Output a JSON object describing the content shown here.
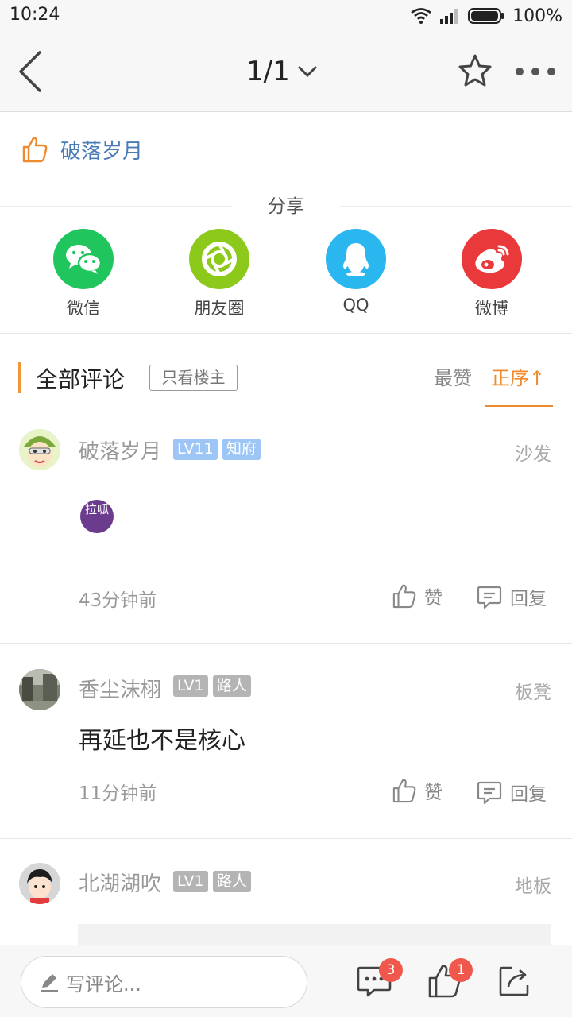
{
  "status_bar": {
    "time": "10:24",
    "battery": "100%"
  },
  "nav": {
    "page_indicator": "1/1"
  },
  "author_like": {
    "name": "破落岁月"
  },
  "share": {
    "title": "分享",
    "items": [
      {
        "label": "微信",
        "icon": "wechat-icon",
        "color": "#21c55d"
      },
      {
        "label": "朋友圈",
        "icon": "moments-icon",
        "color": "#8cc91a"
      },
      {
        "label": "QQ",
        "icon": "qq-icon",
        "color": "#2ab6ee"
      },
      {
        "label": "微博",
        "icon": "weibo-icon",
        "color": "#e9393b"
      }
    ]
  },
  "comments_header": {
    "title": "全部评论",
    "only_author": "只看楼主",
    "sort_hot": "最赞",
    "sort_order": "正序↑"
  },
  "comments": [
    {
      "name": "破落岁月",
      "level": "LV11",
      "title_badge": "知府",
      "floor": "沙发",
      "text": "",
      "sticker": "拉呱",
      "time": "43分钟前",
      "like": "赞",
      "reply": "回复"
    },
    {
      "name": "香尘沫栩",
      "level": "LV1",
      "title_badge": "路人",
      "floor": "板凳",
      "text": "再延也不是核心",
      "time": "11分钟前",
      "like": "赞",
      "reply": "回复"
    },
    {
      "name": "北湖湖吹",
      "level": "LV1",
      "title_badge": "路人",
      "floor": "地板"
    }
  ],
  "bottom_bar": {
    "placeholder": "写评论...",
    "comment_count": "3",
    "like_count": "1"
  },
  "colors": {
    "accent": "#ef8b2e",
    "link": "#4a7bb7",
    "badge_blue": "#9dc5f6",
    "badge_grey": "#b4b4b4",
    "notification": "#f0584d"
  }
}
